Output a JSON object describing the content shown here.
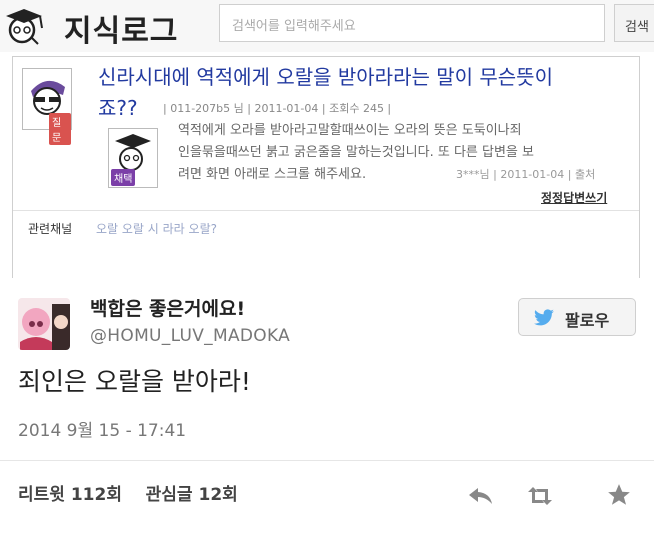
{
  "header": {
    "logo_text": "지식로그",
    "search_placeholder": "검색어를 입력해주세요",
    "search_button": "검색"
  },
  "question": {
    "title_line1": "신라시대에 역적에게 오랄을 받아라라는 말이 무슨뜻이",
    "title_line2": "죠??",
    "meta": "| 011-207b5 님 | 2011-01-04 | 조회수 245 |",
    "asker_tag": "질문",
    "answer_tag": "채택",
    "answer_line1": "역적에게 오라를 받아라고말할때쓰이는 오라의 뜻은 도둑이나죄",
    "answer_line2": "인을묶을때쓰던 붉고 굵은줄을 말하는것입니다. 또 다른 답변을 보",
    "answer_line3": "려면 화면 아래로 스크롤 해주세요.",
    "answer_meta": "3***님 | 2011-01-04 | 출처",
    "more_answers": "정정답변쓰기",
    "related_label": "관련채널",
    "related_links": "오랄 오랄 시 라라 오랄?"
  },
  "tweet": {
    "display_name": "백합은 좋은거에요!",
    "handle": "@HOMU_LUV_MADOKA",
    "follow_label": "팔로우",
    "text": "죄인은 오랄을 받아라!",
    "timestamp": "2014 9월 15 - 17:41",
    "retweets": "리트윗 112회",
    "favorites": "관심글 12회"
  },
  "colors": {
    "title_blue": "#223aa0",
    "asker_tag": "#d9534f",
    "answer_tag": "#7b3fa8",
    "twitter_blue": "#55acee"
  }
}
